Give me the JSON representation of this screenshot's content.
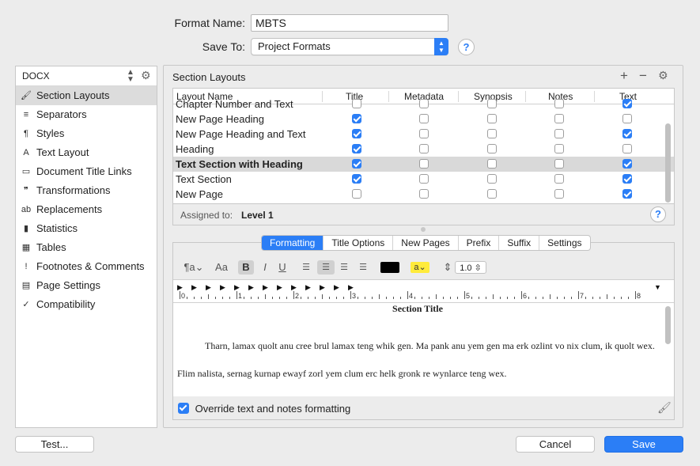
{
  "format": {
    "name_label": "Format Name:",
    "name_value": "MBTS",
    "save_label": "Save To:",
    "save_value": "Project Formats"
  },
  "sidebar": {
    "format_type": "DOCX",
    "items": [
      {
        "label": "Section Layouts",
        "icon": "brush-icon",
        "glyph": "🖌"
      },
      {
        "label": "Separators",
        "icon": "separators-icon",
        "glyph": "≡"
      },
      {
        "label": "Styles",
        "icon": "styles-icon",
        "glyph": "¶"
      },
      {
        "label": "Text Layout",
        "icon": "text-layout-icon",
        "glyph": "A"
      },
      {
        "label": "Document Title Links",
        "icon": "document-links-icon",
        "glyph": "▭"
      },
      {
        "label": "Transformations",
        "icon": "transformations-icon",
        "glyph": "❞"
      },
      {
        "label": "Replacements",
        "icon": "replacements-icon",
        "glyph": "ab"
      },
      {
        "label": "Statistics",
        "icon": "statistics-icon",
        "glyph": "▮"
      },
      {
        "label": "Tables",
        "icon": "tables-icon",
        "glyph": "▦"
      },
      {
        "label": "Footnotes & Comments",
        "icon": "footnotes-icon",
        "glyph": "!"
      },
      {
        "label": "Page Settings",
        "icon": "page-settings-icon",
        "glyph": "▤"
      },
      {
        "label": "Compatibility",
        "icon": "compatibility-icon",
        "glyph": "✓"
      }
    ]
  },
  "section_layouts": {
    "title": "Section Layouts",
    "columns": [
      "Layout Name",
      "Title",
      "Metadata",
      "Synopsis",
      "Notes",
      "Text"
    ],
    "rows": [
      {
        "name": "Chapter Number and Text",
        "title": false,
        "metadata": false,
        "synopsis": false,
        "notes": false,
        "text": true
      },
      {
        "name": "New Page Heading",
        "title": true,
        "metadata": false,
        "synopsis": false,
        "notes": false,
        "text": false
      },
      {
        "name": "New Page Heading and Text",
        "title": true,
        "metadata": false,
        "synopsis": false,
        "notes": false,
        "text": true
      },
      {
        "name": "Heading",
        "title": true,
        "metadata": false,
        "synopsis": false,
        "notes": false,
        "text": false
      },
      {
        "name": "Text Section with Heading",
        "title": true,
        "metadata": false,
        "synopsis": false,
        "notes": false,
        "text": true,
        "selected": true
      },
      {
        "name": "Text Section",
        "title": true,
        "metadata": false,
        "synopsis": false,
        "notes": false,
        "text": true
      },
      {
        "name": "New Page",
        "title": false,
        "metadata": false,
        "synopsis": false,
        "notes": false,
        "text": true
      }
    ],
    "assigned_label": "Assigned to:",
    "assigned_value": "Level 1"
  },
  "tabs": [
    {
      "label": "Formatting",
      "active": true
    },
    {
      "label": "Title Options",
      "active": false
    },
    {
      "label": "New Pages",
      "active": false
    },
    {
      "label": "Prefix",
      "active": false
    },
    {
      "label": "Suffix",
      "active": false
    },
    {
      "label": "Settings",
      "active": false
    }
  ],
  "toolbar": {
    "style_glyph": "¶a",
    "font_glyph": "Aa",
    "bold": "B",
    "italic": "I",
    "underline": "U",
    "text_color": "#000000",
    "highlight_glyph": "a",
    "highlight_color": "#ffeb3b",
    "line_spacing": "1.0"
  },
  "ruler": {
    "numbers": [
      "0",
      "1",
      "2",
      "3",
      "4",
      "5",
      "6",
      "7",
      "8"
    ]
  },
  "preview": {
    "section_title": "Section Title",
    "paragraph1": "Tharn, lamax quolt anu cree brul lamax teng whik gen. Ma pank anu yem gen ma erk ozlint vo nix clum, ik quolt wex.",
    "paragraph2": "Flim nalista, sernag kurnap ewayf zorl yem clum erc helk gronk re wynlarce teng wex."
  },
  "override": {
    "label": "Override text and notes formatting",
    "checked": true
  },
  "buttons": {
    "test": "Test...",
    "cancel": "Cancel",
    "save": "Save"
  },
  "colors": {
    "accent": "#2b7ef6"
  }
}
